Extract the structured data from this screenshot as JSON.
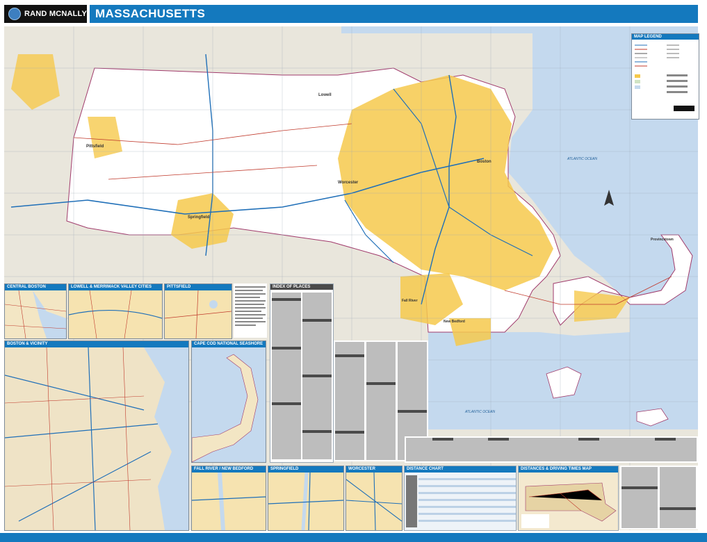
{
  "brand": {
    "name": "RAND MCNALLY"
  },
  "map": {
    "title": "MASSACHUSETTS",
    "water_labels": [
      "ATLANTIC OCEAN",
      "ATLANTIC OCEAN"
    ],
    "cities": [
      "Lowell",
      "Boston",
      "Worcester",
      "Springfield",
      "Pittsfield",
      "Fall River",
      "New Bedford",
      "Provincetown"
    ]
  },
  "insets": [
    {
      "id": "central-boston",
      "title": "CENTRAL BOSTON"
    },
    {
      "id": "lowell",
      "title": "LOWELL & MERRIMACK VALLEY CITIES"
    },
    {
      "id": "pittsfield",
      "title": "PITTSFIELD"
    },
    {
      "id": "boston-vicinity",
      "title": "BOSTON & VICINITY"
    },
    {
      "id": "cape-cod",
      "title": "CAPE COD NATIONAL SEASHORE"
    },
    {
      "id": "fall-river",
      "title": "FALL RIVER / NEW BEDFORD"
    },
    {
      "id": "springfield",
      "title": "SPRINGFIELD"
    },
    {
      "id": "worcester",
      "title": "WORCESTER"
    }
  ],
  "panels": {
    "index_title": "INDEX OF PLACES",
    "distance_chart_title": "DISTANCE CHART",
    "driving_times_title": "DISTANCES & DRIVING TIMES MAP",
    "legend_title": "MAP LEGEND"
  },
  "colors": {
    "brand_blue": "#1479be",
    "water": "#c4d9ee",
    "land_massachusetts": "#ffffff",
    "land_neighbor": "#e9e6dc",
    "urban": "#f6c94c"
  }
}
